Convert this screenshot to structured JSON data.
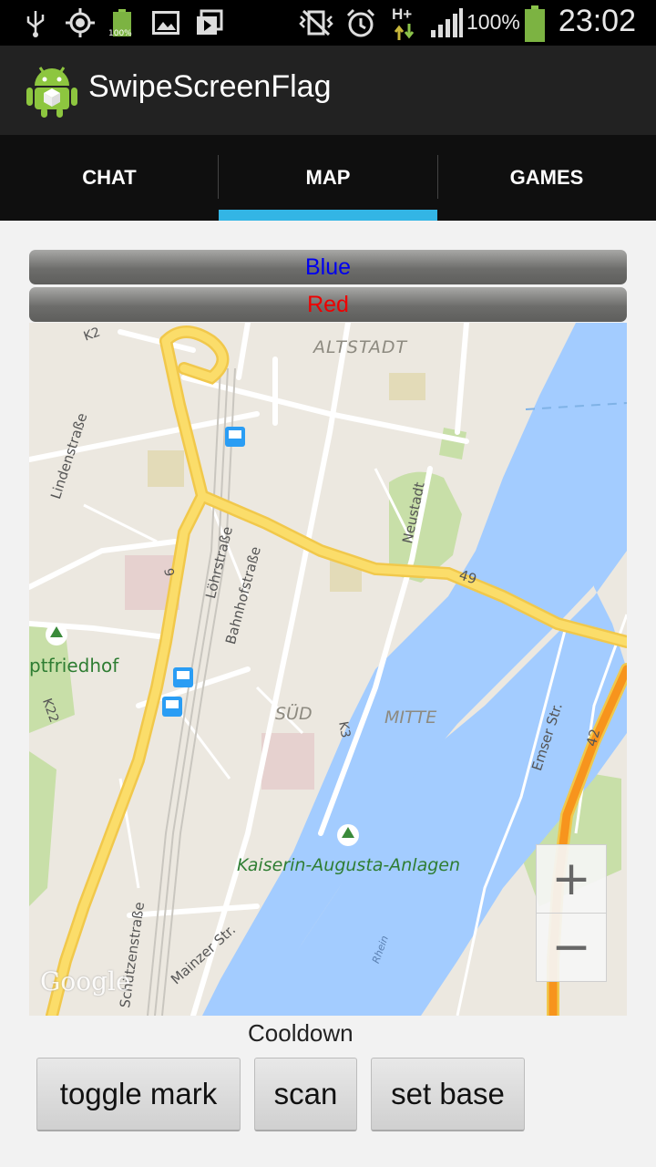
{
  "status_bar": {
    "battery_small_label": "100%",
    "network_label": "H+",
    "battery_percent": "100%",
    "time": "23:02",
    "icons": [
      "usb-icon",
      "gps-icon",
      "battery-icon",
      "gallery-icon",
      "video-icon",
      "vibrate-off-icon",
      "alarm-icon",
      "data-arrows-icon",
      "signal-icon",
      "battery-icon"
    ]
  },
  "action_bar": {
    "title": "SwipeScreenFlag",
    "icon": "android-icon"
  },
  "tabs": [
    {
      "label": "CHAT"
    },
    {
      "label": "MAP"
    },
    {
      "label": "GAMES"
    }
  ],
  "active_tab": "MAP",
  "team_buttons": {
    "blue": {
      "label": "Blue",
      "color": "#0000ee"
    },
    "red": {
      "label": "Red",
      "color": "#ee0000"
    }
  },
  "map": {
    "labels": {
      "altstadt": "ALTSTADT",
      "sued": "SÜD",
      "mitte": "MITTE",
      "lindenstrasse": "Lindenstraße",
      "loehrstrasse": "Löhrstraße",
      "bahnhofstrasse": "Bahnhofstraße",
      "neustadt": "Neustadt",
      "friedhof": "ptfriedhof",
      "k22": "K22",
      "k2": "K2",
      "k3": "K3",
      "road9": "9",
      "road49": "49",
      "road42": "42",
      "emser": "Emser Str.",
      "kaiserin": "Kaiserin-Augusta-Anlagen",
      "schuetzen": "Schützenstraße",
      "mainzer": "Mainzer Str.",
      "rhein": "Rhein",
      "google": "Google"
    },
    "zoom_in": "+",
    "zoom_out": "−",
    "colors": {
      "water": "#a3ccff",
      "road_major": "#fbdd6a",
      "park": "#c8dfa8",
      "land": "#ece8e0"
    }
  },
  "cooldown_label": "Cooldown",
  "actions": {
    "toggle_mark": "toggle mark",
    "scan": "scan",
    "set_base": "set base"
  }
}
